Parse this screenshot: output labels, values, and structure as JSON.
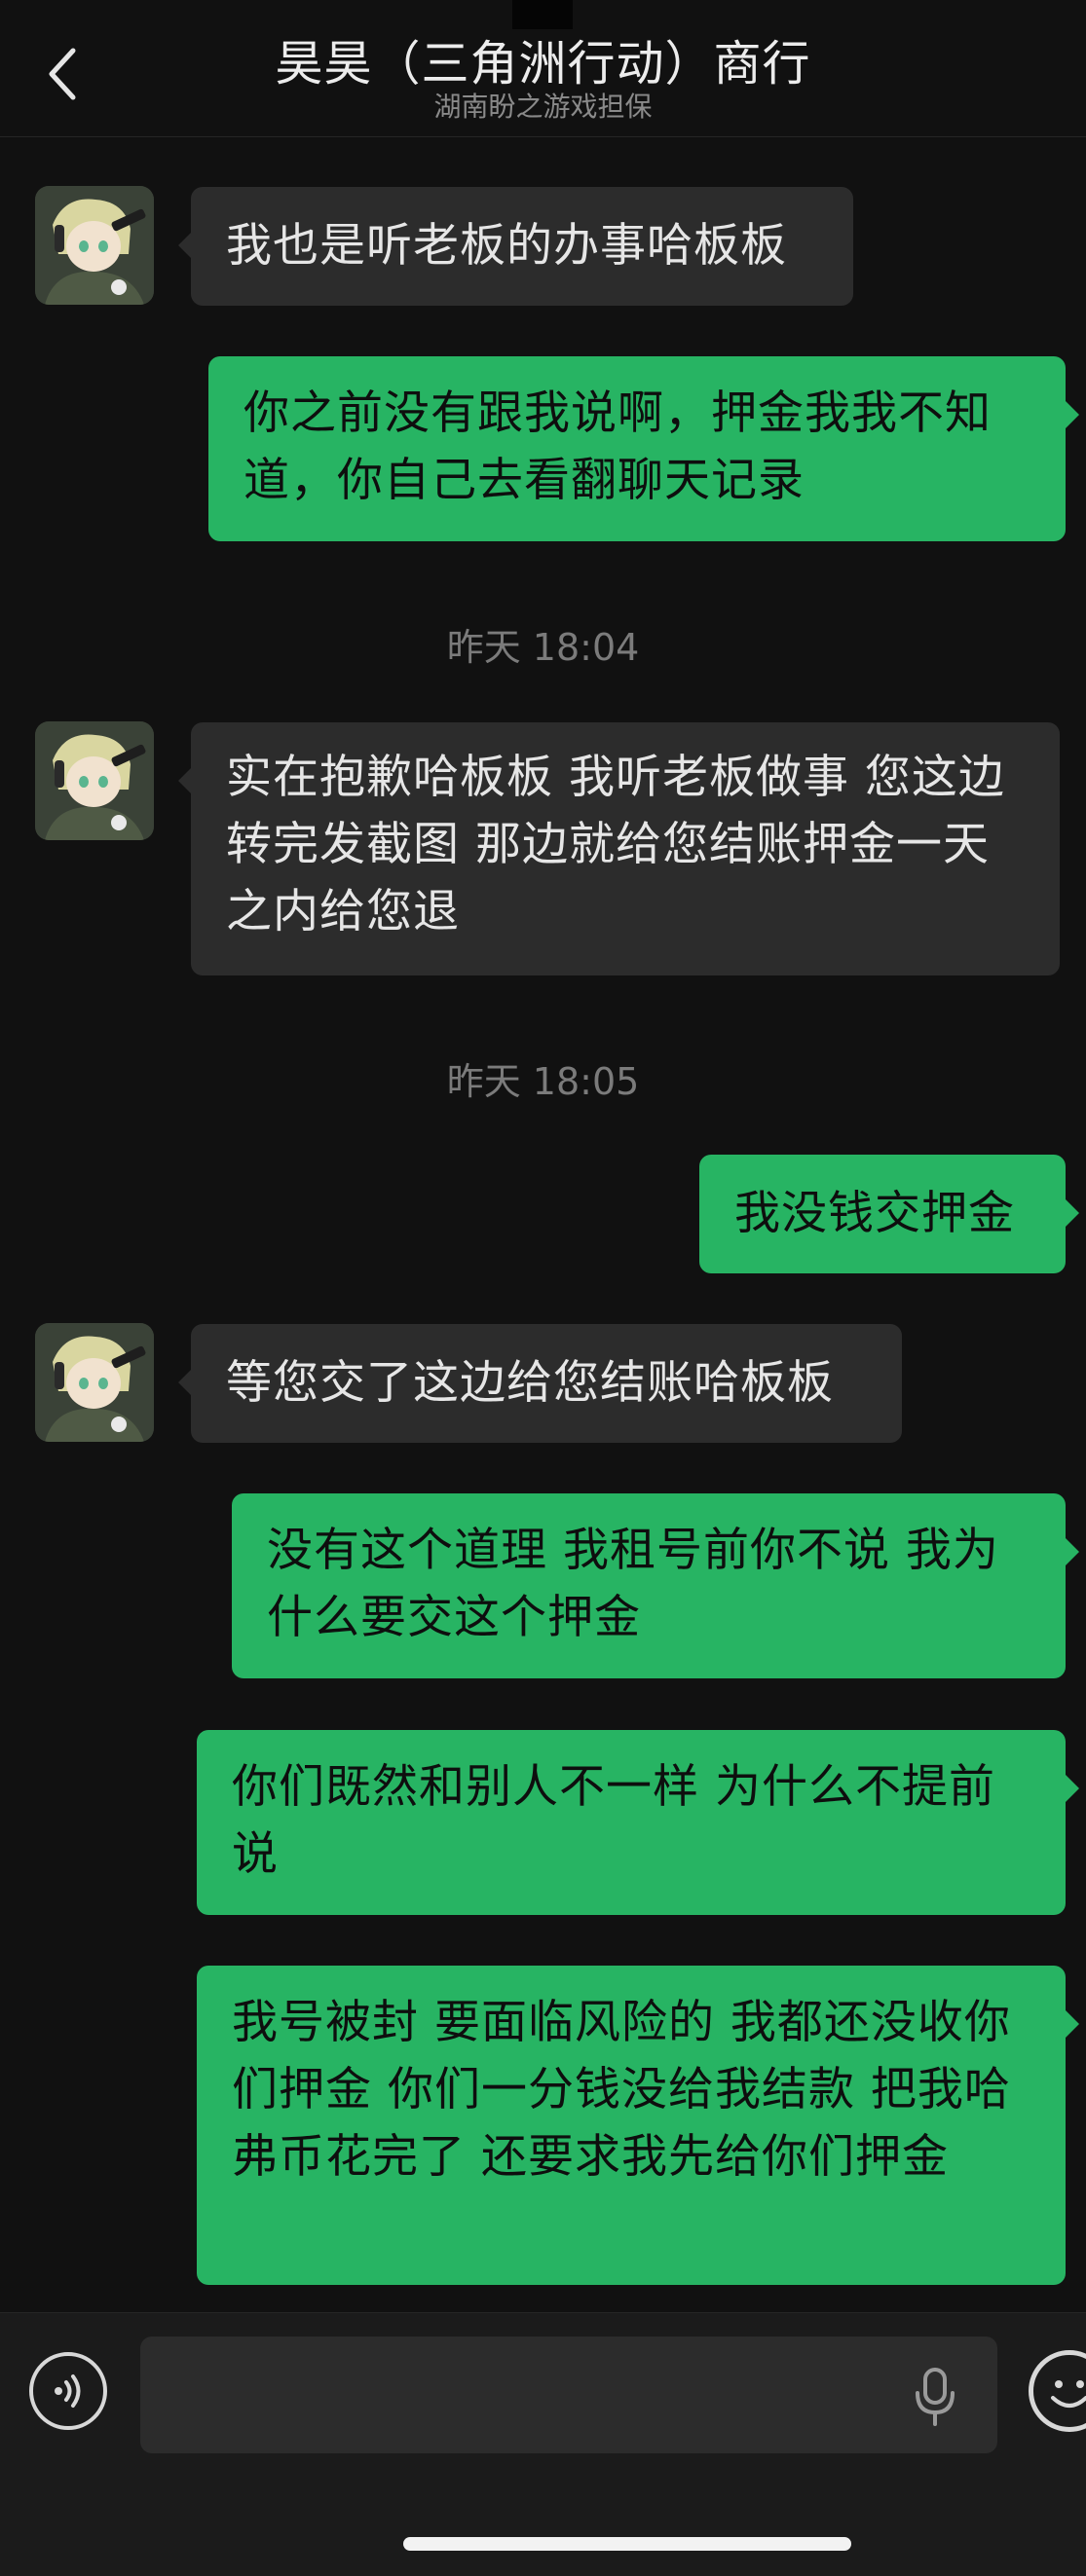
{
  "header": {
    "back_label": "<",
    "title": "昊昊（三角洲行动）商行",
    "subtitle": "湖南盼之游戏担保"
  },
  "messages": [
    {
      "side": "in",
      "text": "我也是听老板的办事哈板板"
    },
    {
      "side": "out",
      "text": "你之前没有跟我说啊，押金我我不知道，你自己去看翻聊天记录"
    },
    {
      "type": "time",
      "text": "昨天 18:04"
    },
    {
      "side": "in",
      "text": "实在抱歉哈板板 我听老板做事 您这边转完发截图 那边就给您结账押金一天之内给您退"
    },
    {
      "type": "time",
      "text": "昨天 18:05"
    },
    {
      "side": "out",
      "text": "我没钱交押金"
    },
    {
      "side": "in",
      "text": "等您交了这边给您结账哈板板"
    },
    {
      "side": "out",
      "text": "没有这个道理 我租号前你不说 我为什么要交这个押金"
    },
    {
      "side": "out",
      "text": "你们既然和别人不一样 为什么不提前说"
    },
    {
      "side": "out",
      "text": "我号被封 要面临风险的 我都还没收你们押金 你们一分钱没给我结款 把我哈弗币花完了 还要求我先给你们押金"
    }
  ],
  "input": {
    "value": "",
    "placeholder": ""
  },
  "colors": {
    "background": "#111111",
    "incoming_bubble": "#2c2c2c",
    "outgoing_bubble": "#27b463",
    "timestamp": "#7b7b7b"
  },
  "icons": {
    "back": "chevron-left-icon",
    "voice": "voice-wave-icon",
    "mic": "microphone-icon",
    "emoji": "emoji-icon"
  }
}
